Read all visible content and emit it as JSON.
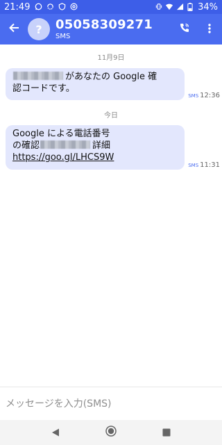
{
  "status_bar": {
    "time": "21:49",
    "battery": "34%",
    "icons": [
      "whatsapp-icon",
      "sync-icon",
      "shield-icon",
      "at-icon",
      "vibrate-icon",
      "wifi-icon",
      "signal-icon",
      "battery-icon"
    ]
  },
  "app_bar": {
    "back_icon": "arrow-back-icon",
    "avatar_text": "?",
    "title": "05058309271",
    "subtitle": "SMS",
    "call_icon": "phone-call-icon",
    "menu_icon": "more-vertical-icon"
  },
  "colors": {
    "primary": "#4a6cf0",
    "status_bar": "#3d5ee8",
    "bubble": "#e3e7fd",
    "sms_tag": "#4a6cf0"
  },
  "conversation": {
    "groups": [
      {
        "date": "11月9日",
        "message": {
          "text_line1": "があなたの Google 確",
          "text_line2": "認コードです。",
          "sms_tag": "SMS",
          "time": "12:36"
        }
      },
      {
        "date": "今日",
        "message": {
          "text_line1": "Google による電話番号",
          "text_line2_prefix": "の確認",
          "text_line2_suffix": "詳細",
          "link": "https://goo.gl/LHCS9W",
          "sms_tag": "SMS",
          "time": "11:31"
        }
      }
    ]
  },
  "compose": {
    "placeholder": "メッセージを入力(SMS)"
  },
  "nav_bar": {
    "icons": [
      "nav-back-icon",
      "nav-home-icon",
      "nav-recents-icon"
    ]
  }
}
